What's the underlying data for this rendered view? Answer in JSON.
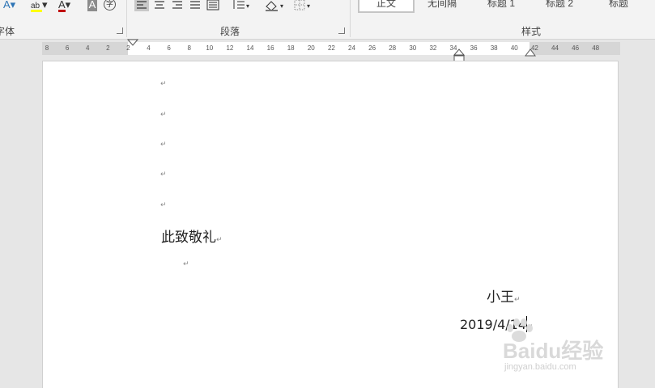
{
  "ribbon": {
    "font_group_label": "字体",
    "paragraph_group_label": "段落",
    "styles_group_label": "样式",
    "styles": [
      {
        "label": "正文",
        "selected": true
      },
      {
        "label": "无间隔",
        "selected": false
      },
      {
        "label": "标题 1",
        "selected": false
      },
      {
        "label": "标题 2",
        "selected": false
      },
      {
        "label": "标题",
        "selected": false
      }
    ],
    "icons": [
      "text-effects-icon",
      "highlight-icon",
      "font-color-icon",
      "character-shading-icon",
      "enclose-character-icon",
      "align-left-icon",
      "align-center-icon",
      "align-right-icon",
      "justify-icon",
      "distributed-icon",
      "line-spacing-icon",
      "shading-icon",
      "borders-icon"
    ],
    "highlight_color": "#ffff00",
    "font_color": "#c00000"
  },
  "ruler": {
    "ticks": [
      "8",
      "6",
      "4",
      "2",
      "2",
      "4",
      "6",
      "8",
      "10",
      "12",
      "14",
      "16",
      "18",
      "20",
      "22",
      "24",
      "26",
      "28",
      "30",
      "32",
      "34",
      "36",
      "38",
      "40",
      "42",
      "44",
      "46",
      "48"
    ]
  },
  "document": {
    "paragraph_mark": "↵",
    "closing_text": "此致敬礼",
    "signature_name": "小王",
    "date": "2019/4/14"
  },
  "watermark": {
    "brand": "Baidu经验",
    "url": "jingyan.baidu.com"
  }
}
